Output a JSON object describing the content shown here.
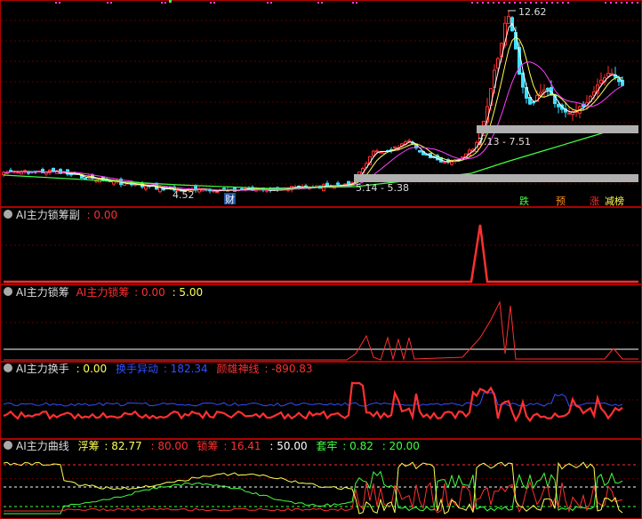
{
  "colors": {
    "bg": "#000000",
    "frame": "#b00000",
    "grid": "#5a0000",
    "up": "#ff3030",
    "down": "#40e0ff",
    "white": "#ffffff",
    "yellow": "#ffff55",
    "magenta": "#ff40ff",
    "green": "#40ff40",
    "blue": "#3050ff",
    "gray": "#b0b0b0",
    "label_gray": "#dddddd",
    "orange": "#ff9020"
  },
  "main": {
    "price_high_label": "12.62",
    "price_low_label": "4.52",
    "band_upper_label": "7.13 - 7.51",
    "band_lower_label": "5.14 - 5.38",
    "finance_marker": "财",
    "signal_tags": [
      {
        "text": "跌",
        "color": "#40ff40"
      },
      {
        "text": "预",
        "color": "#ff9020"
      },
      {
        "text": "涨",
        "color": "#ff3030"
      },
      {
        "text": "减榜",
        "color": "#ffff55"
      }
    ]
  },
  "panels": [
    {
      "title": "AI主力锁筹副",
      "items": [
        {
          "text": ": 0.00",
          "color": "#ff3030"
        }
      ]
    },
    {
      "title": "AI主力锁筹",
      "items": [
        {
          "text": "AI主力锁筹",
          "color": "#ff3030"
        },
        {
          "text": ": 0.00",
          "color": "#ff3030"
        },
        {
          "text": ": 5.00",
          "color": "#ffff55"
        }
      ]
    },
    {
      "title": "AI主力换手",
      "items": [
        {
          "text": ": 0.00",
          "color": "#ffff55"
        },
        {
          "text": "换手异动",
          "color": "#3050ff"
        },
        {
          "text": ": 182.34",
          "color": "#3050ff"
        },
        {
          "text": "颜雄神线",
          "color": "#ff3030"
        },
        {
          "text": ": -890.83",
          "color": "#ff3030"
        }
      ]
    },
    {
      "title": "AI主力曲线",
      "items": [
        {
          "text": "浮筹",
          "color": "#ffff55"
        },
        {
          "text": ": 82.77",
          "color": "#ffff55"
        },
        {
          "text": ": 80.00",
          "color": "#ff3030"
        },
        {
          "text": "锁筹",
          "color": "#ff3030"
        },
        {
          "text": ": 16.41",
          "color": "#ff3030"
        },
        {
          "text": ": 50.00",
          "color": "#ffffff"
        },
        {
          "text": "套牢",
          "color": "#40ff40"
        },
        {
          "text": ": 0.82",
          "color": "#40ff40"
        },
        {
          "text": ": 20.00",
          "color": "#40ff40"
        }
      ]
    }
  ]
}
